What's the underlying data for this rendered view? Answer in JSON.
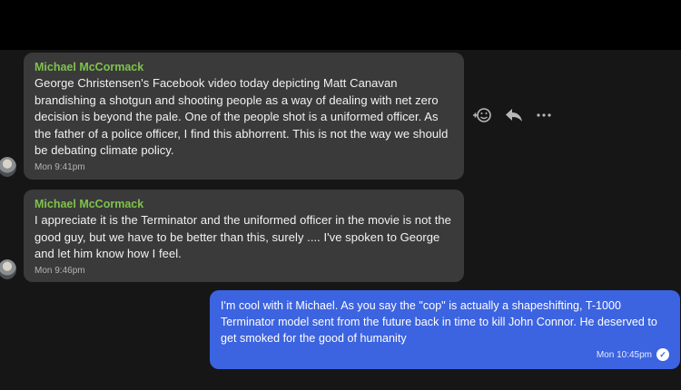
{
  "messages": [
    {
      "sender": "Michael McCormack",
      "text": "George Christensen's Facebook video today depicting Matt Canavan brandishing a shotgun and shooting people as a way of dealing with net zero decision is beyond the pale. One of the people shot is a uniformed officer. As the father of a police officer, I find this abhorrent. This is not the way we should be debating climate policy.",
      "time": "Mon 9:41pm"
    },
    {
      "sender": "Michael McCormack",
      "text": "I appreciate it is the Terminator and the uniformed officer in the movie is not the good guy, but we have to be better than this, surely .... I've spoken to George and let him know how I feel.",
      "time": "Mon 9:46pm"
    },
    {
      "text": "I'm cool with it Michael. As you say the \"cop\" is actually a shapeshifting, T-1000 Terminator model sent from the future back in time to kill John Connor. He deserved to get smoked for the good of humanity",
      "time": "Mon 10:45pm"
    }
  ],
  "actions": {
    "react_icon": "add-reaction-icon",
    "reply_icon": "reply-icon",
    "more_icon": "more-icon"
  },
  "colors": {
    "background": "#161616",
    "incoming_bubble": "#3a3a3b",
    "outgoing_bubble": "#3c63e0",
    "sender_name": "#7fc24a"
  }
}
